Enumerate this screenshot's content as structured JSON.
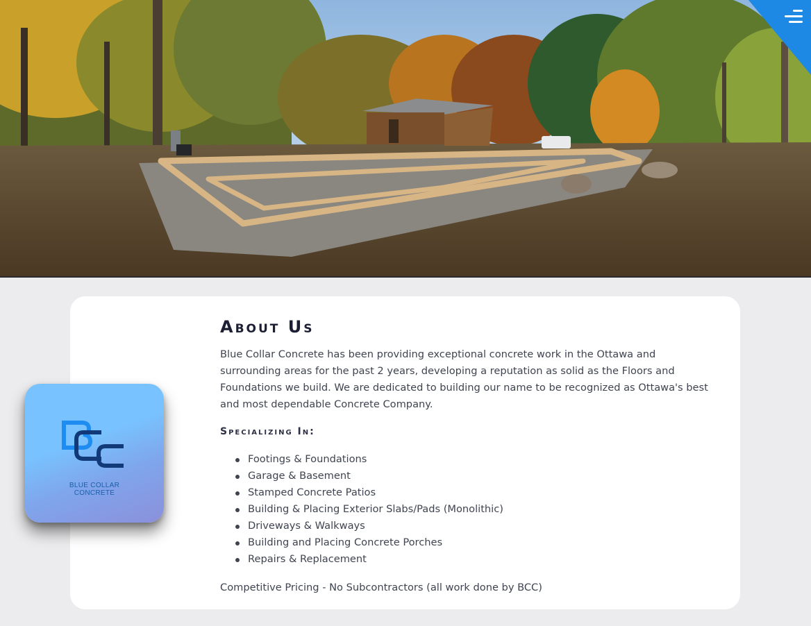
{
  "hero": {
    "image_name": "concrete-footing-forms-photo"
  },
  "nav": {
    "menu_icon": "hamburger-menu-icon",
    "accent": "#1e88e5"
  },
  "logo": {
    "initials": "BCC",
    "line1": "BLUE COLLAR",
    "line2": "CONCRETE"
  },
  "about": {
    "title": "About Us",
    "intro": "Blue Collar Concrete has been providing exceptional concrete work in the Ottawa and surrounding areas for the past 2 years, developing a reputation as solid as the Floors and Foundations we build. We are dedicated to building our name to be recognized as Ottawa's best and most dependable Concrete Company.",
    "specializing_heading": "Specializing In:",
    "services": [
      "Footings & Foundations",
      "Garage & Basement",
      "Stamped Concrete Patios",
      "Building & Placing Exterior Slabs/Pads (Monolithic)",
      "Driveways & Walkways",
      "Building and Placing Concrete Porches",
      "Repairs & Replacement"
    ],
    "footer": "Competitive Pricing - No Subcontractors (all work done by BCC)"
  }
}
